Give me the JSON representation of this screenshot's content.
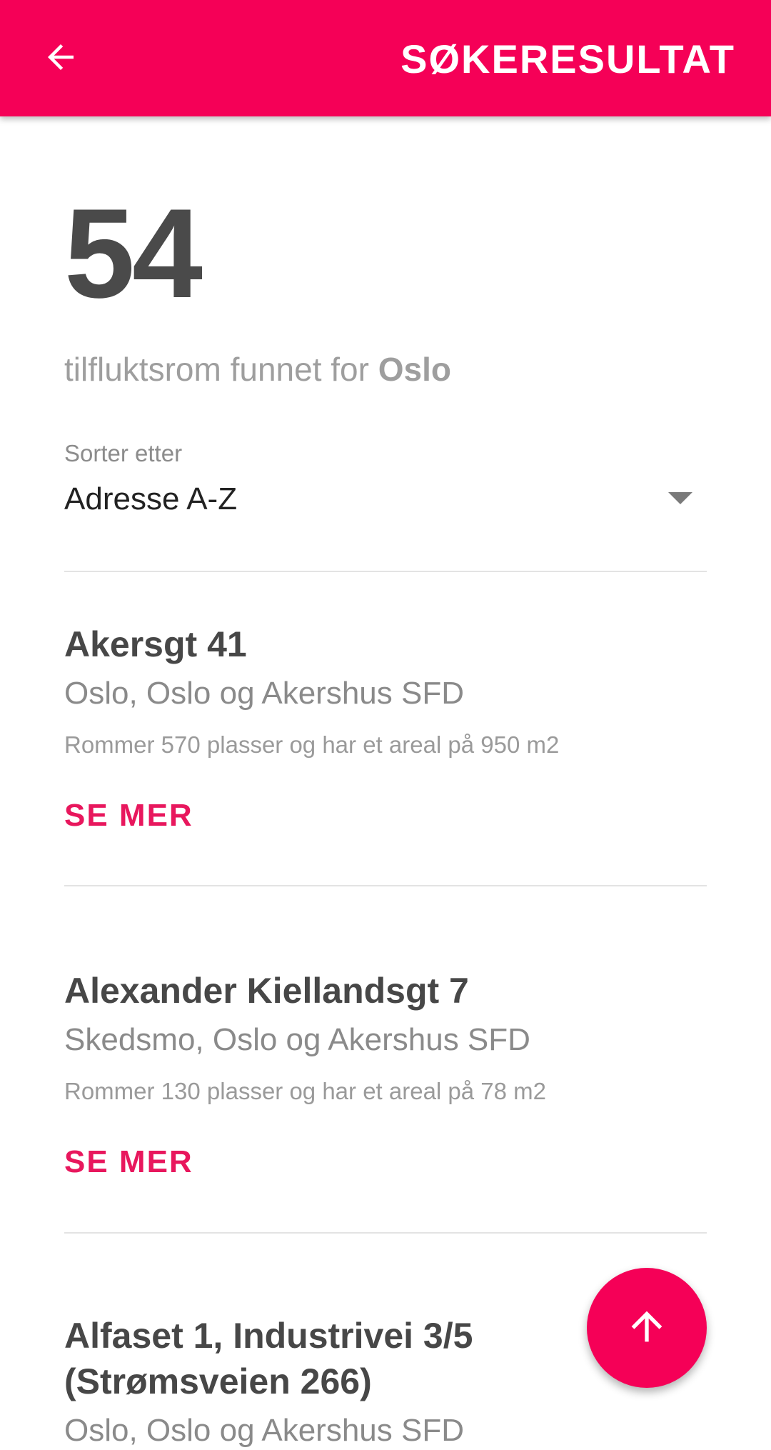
{
  "app_bar": {
    "title": "SØKERESULTAT",
    "back_icon": "arrow-left-icon",
    "background_color": "#f50057"
  },
  "summary": {
    "count": "54",
    "text_prefix": "tilfluktsrom funnet for ",
    "city": "Oslo"
  },
  "sort": {
    "label": "Sorter etter",
    "selected": "Adresse A-Z",
    "caret_icon": "dropdown-caret-icon"
  },
  "results": [
    {
      "title": "Akersgt 41",
      "location": "Oslo, Oslo og Akershus SFD",
      "info": "Rommer 570 plasser og har et areal på 950 m2",
      "action": "SE MER"
    },
    {
      "title": "Alexander Kiellandsgt 7",
      "location": "Skedsmo, Oslo og Akershus SFD",
      "info": "Rommer 130 plasser og har et areal på 78 m2",
      "action": "SE MER"
    },
    {
      "title_line1": "Alfaset 1, Industrivei 3/5",
      "title_line2": "(Strømsveien 266)",
      "location": "Oslo, Oslo og Akershus SFD"
    }
  ],
  "fab": {
    "icon": "arrow-up-icon",
    "color": "#f50057"
  },
  "colors": {
    "accent": "#f50057",
    "link": "#e8175d"
  }
}
